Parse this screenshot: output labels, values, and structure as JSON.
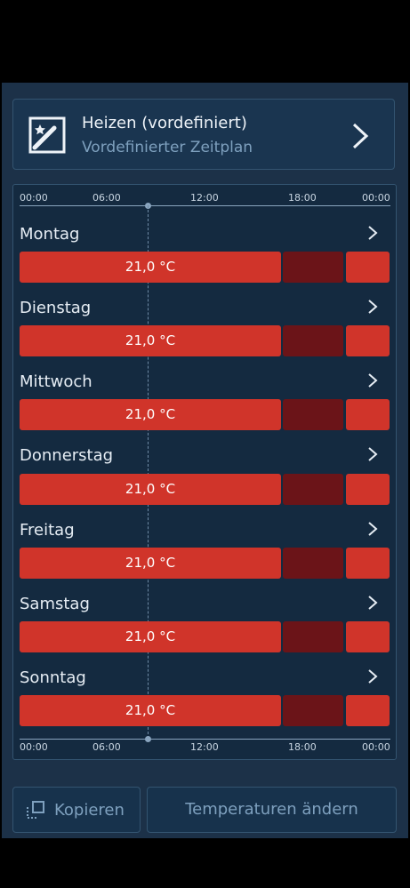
{
  "mode": {
    "title": "Heizen (vordefiniert)",
    "subtitle": "Vordefinierter Zeitplan"
  },
  "axis": {
    "ticks": [
      "00:00",
      "06:00",
      "12:00",
      "18:00",
      "00:00"
    ]
  },
  "days": [
    {
      "name": "Montag",
      "temp": "21,0 °C"
    },
    {
      "name": "Dienstag",
      "temp": "21,0 °C"
    },
    {
      "name": "Mittwoch",
      "temp": "21,0 °C"
    },
    {
      "name": "Donnerstag",
      "temp": "21,0 °C"
    },
    {
      "name": "Freitag",
      "temp": "21,0 °C"
    },
    {
      "name": "Samstag",
      "temp": "21,0 °C"
    },
    {
      "name": "Sonntag",
      "temp": "21,0 °C"
    }
  ],
  "buttons": {
    "copy": "Kopieren",
    "change_temps": "Temperaturen ändern"
  },
  "colors": {
    "heat": "#d0342a",
    "reduced": "#6b1418",
    "background": "#1c3148"
  }
}
